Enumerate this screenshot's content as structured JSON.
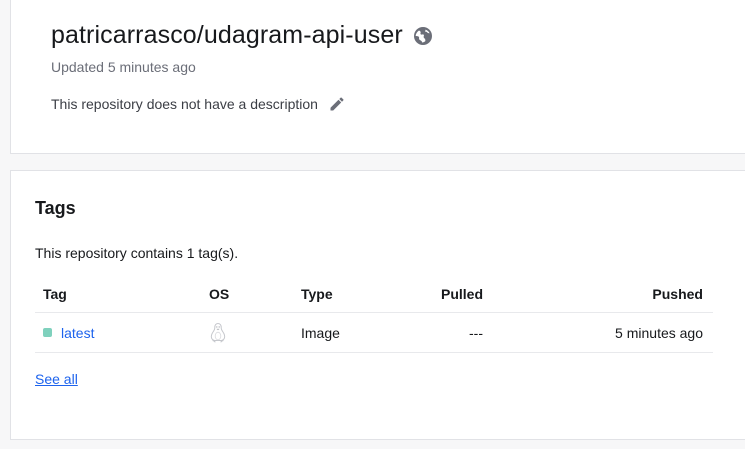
{
  "repo": {
    "name": "patricarrasco/udagram-api-user",
    "visibility_icon": "globe-icon",
    "updated": "Updated 5 minutes ago",
    "description": "This repository does not have a description",
    "edit_icon": "pencil-icon"
  },
  "tags": {
    "heading": "Tags",
    "summary": "This repository contains 1 tag(s).",
    "columns": {
      "tag": "Tag",
      "os": "OS",
      "type": "Type",
      "pulled": "Pulled",
      "pushed": "Pushed"
    },
    "rows": [
      {
        "tag": "latest",
        "os_icon": "linux-icon",
        "type": "Image",
        "pulled": "---",
        "pushed": "5 minutes ago"
      }
    ],
    "see_all": "See all"
  },
  "colors": {
    "link": "#1d63ed",
    "tag_dot": "#7fd1bd",
    "muted": "#6b6e78"
  }
}
